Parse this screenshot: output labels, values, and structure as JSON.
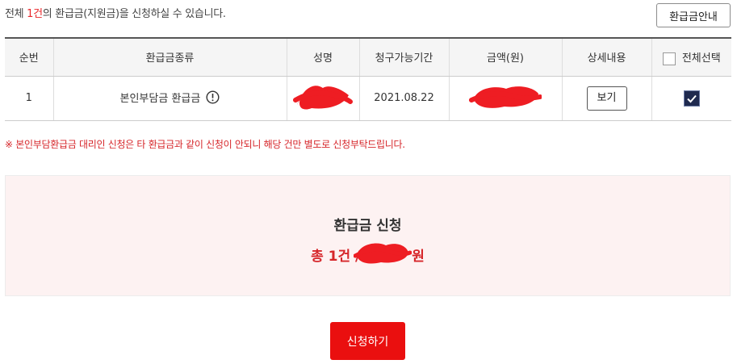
{
  "header": {
    "text_before": "전체 ",
    "count": "1건",
    "text_after": "의 환급금(지원금)을 신청하실 수 있습니다.",
    "guide_button": "환급금안내"
  },
  "table": {
    "columns": [
      "순번",
      "환급금종류",
      "성명",
      "청구가능기간",
      "금액(원)",
      "상세내용",
      "전체선택"
    ],
    "rows": [
      {
        "no": "1",
        "type": "본인부담금 환급금",
        "name": "",
        "period": "2021.08.22",
        "amount": "",
        "detail_button": "보기",
        "selected": true
      }
    ],
    "select_all_checked": false
  },
  "notice": "※ 본인부담환급금 대리인 신청은 타 환급금과 같이 신청이 안되니 해당 건만 별도로 신청부탁드립니다.",
  "summary": {
    "title": "환급금 신청",
    "total_prefix": "총 1건 /",
    "total_amount": "",
    "total_suffix": "원"
  },
  "apply_button": "신청하기",
  "colors": {
    "accent_red": "#ea0f0f",
    "summary_bg": "#fdf2f2",
    "checkbox_checked": "#1f2a4f"
  },
  "icons": [
    "info-circle-icon",
    "checkmark-icon"
  ]
}
